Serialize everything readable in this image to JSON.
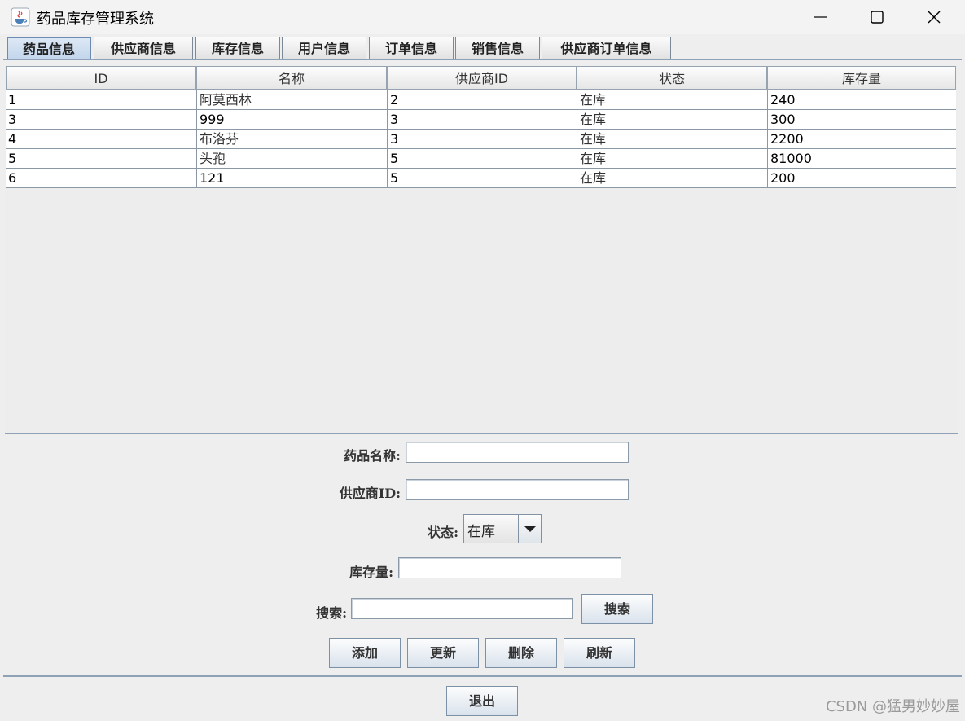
{
  "window": {
    "title": "药品库存管理系统",
    "icon": "java-cup-icon",
    "controls": [
      "minimize-icon",
      "maximize-icon",
      "close-icon"
    ]
  },
  "tabs": [
    {
      "label": "药品信息",
      "active": true
    },
    {
      "label": "供应商信息",
      "active": false
    },
    {
      "label": "库存信息",
      "active": false
    },
    {
      "label": "用户信息",
      "active": false
    },
    {
      "label": "订单信息",
      "active": false
    },
    {
      "label": "销售信息",
      "active": false
    },
    {
      "label": "供应商订单信息",
      "active": false
    }
  ],
  "table": {
    "headers": [
      "ID",
      "名称",
      "供应商ID",
      "状态",
      "库存量"
    ],
    "rows": [
      [
        "1",
        "阿莫西林",
        "2",
        "在库",
        "240"
      ],
      [
        "3",
        "999",
        "3",
        "在库",
        "300"
      ],
      [
        "4",
        "布洛芬",
        "3",
        "在库",
        "2200"
      ],
      [
        "5",
        "头孢",
        "5",
        "在库",
        "81000"
      ],
      [
        "6",
        "121",
        "5",
        "在库",
        "200"
      ]
    ]
  },
  "form": {
    "name_label": "药品名称:",
    "name_value": "",
    "supplier_label": "供应商ID:",
    "supplier_value": "",
    "status_label": "状态:",
    "status_value": "在库",
    "stock_label": "库存量:",
    "stock_value": "",
    "search_label": "搜索:",
    "search_value": "",
    "search_button": "搜索"
  },
  "actions": {
    "add": "添加",
    "update": "更新",
    "delete": "删除",
    "refresh": "刷新",
    "exit": "退出"
  },
  "watermark": "CSDN @猛男妙妙屋",
  "colors": {
    "window_bg": "#eeeeee",
    "titlebar_bg": "#f3f3f3",
    "active_tab": "#c3d6ec",
    "border": "#8ea1b6"
  }
}
